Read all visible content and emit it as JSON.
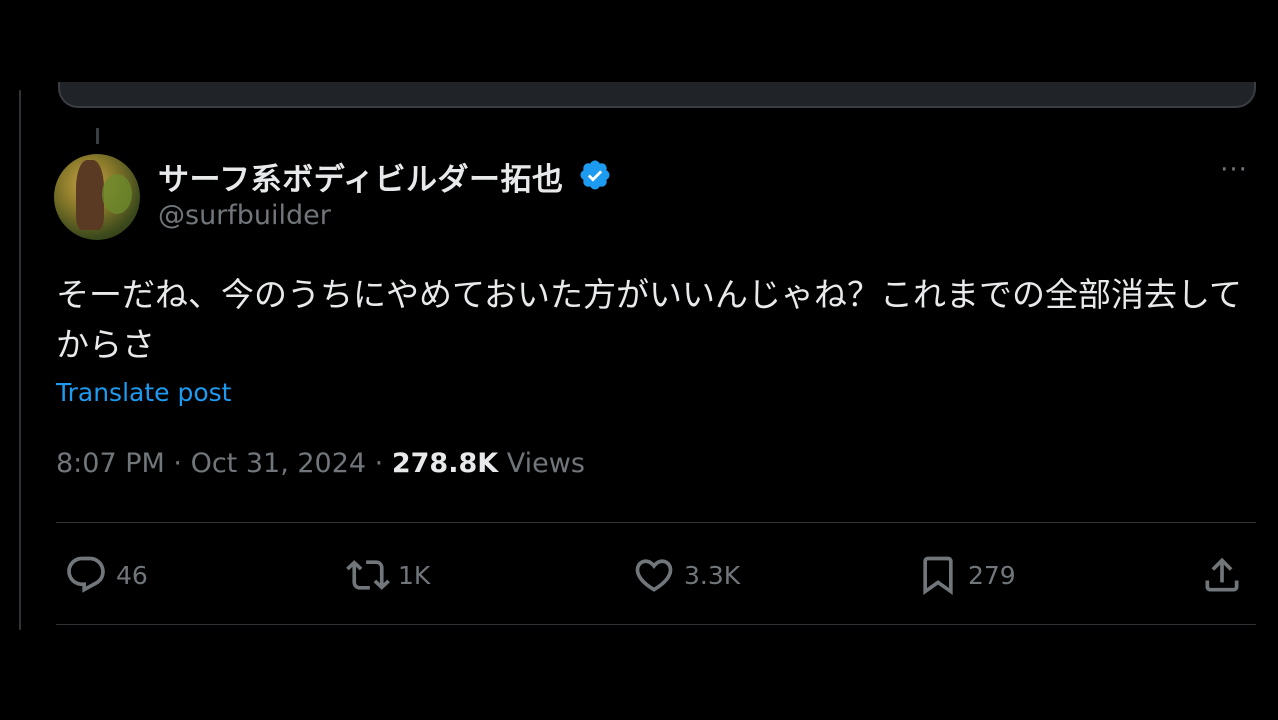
{
  "tweet": {
    "display_name": "サーフ系ボディビルダー拓也",
    "handle": "@surfbuilder",
    "text": "そーだね、今のうちにやめておいた方がいいんじゃね？これまでの全部消去してからさ",
    "translate_label": "Translate post",
    "time": "8:07 PM",
    "separator": "·",
    "date": "Oct 31, 2024",
    "views_count": "278.8K",
    "views_label": "Views",
    "more_label": "···"
  },
  "actions": {
    "reply_count": "46",
    "retweet_count": "1K",
    "like_count": "3.3K",
    "bookmark_count": "279"
  },
  "icons": {
    "verified": "verified-badge-icon",
    "reply": "reply-icon",
    "retweet": "retweet-icon",
    "like": "heart-icon",
    "bookmark": "bookmark-icon",
    "share": "share-icon",
    "more": "more-icon"
  },
  "colors": {
    "background": "#000000",
    "text_primary": "#e7e9ea",
    "text_secondary": "#71767b",
    "link": "#1d9bf0",
    "divider": "#2f3336"
  }
}
